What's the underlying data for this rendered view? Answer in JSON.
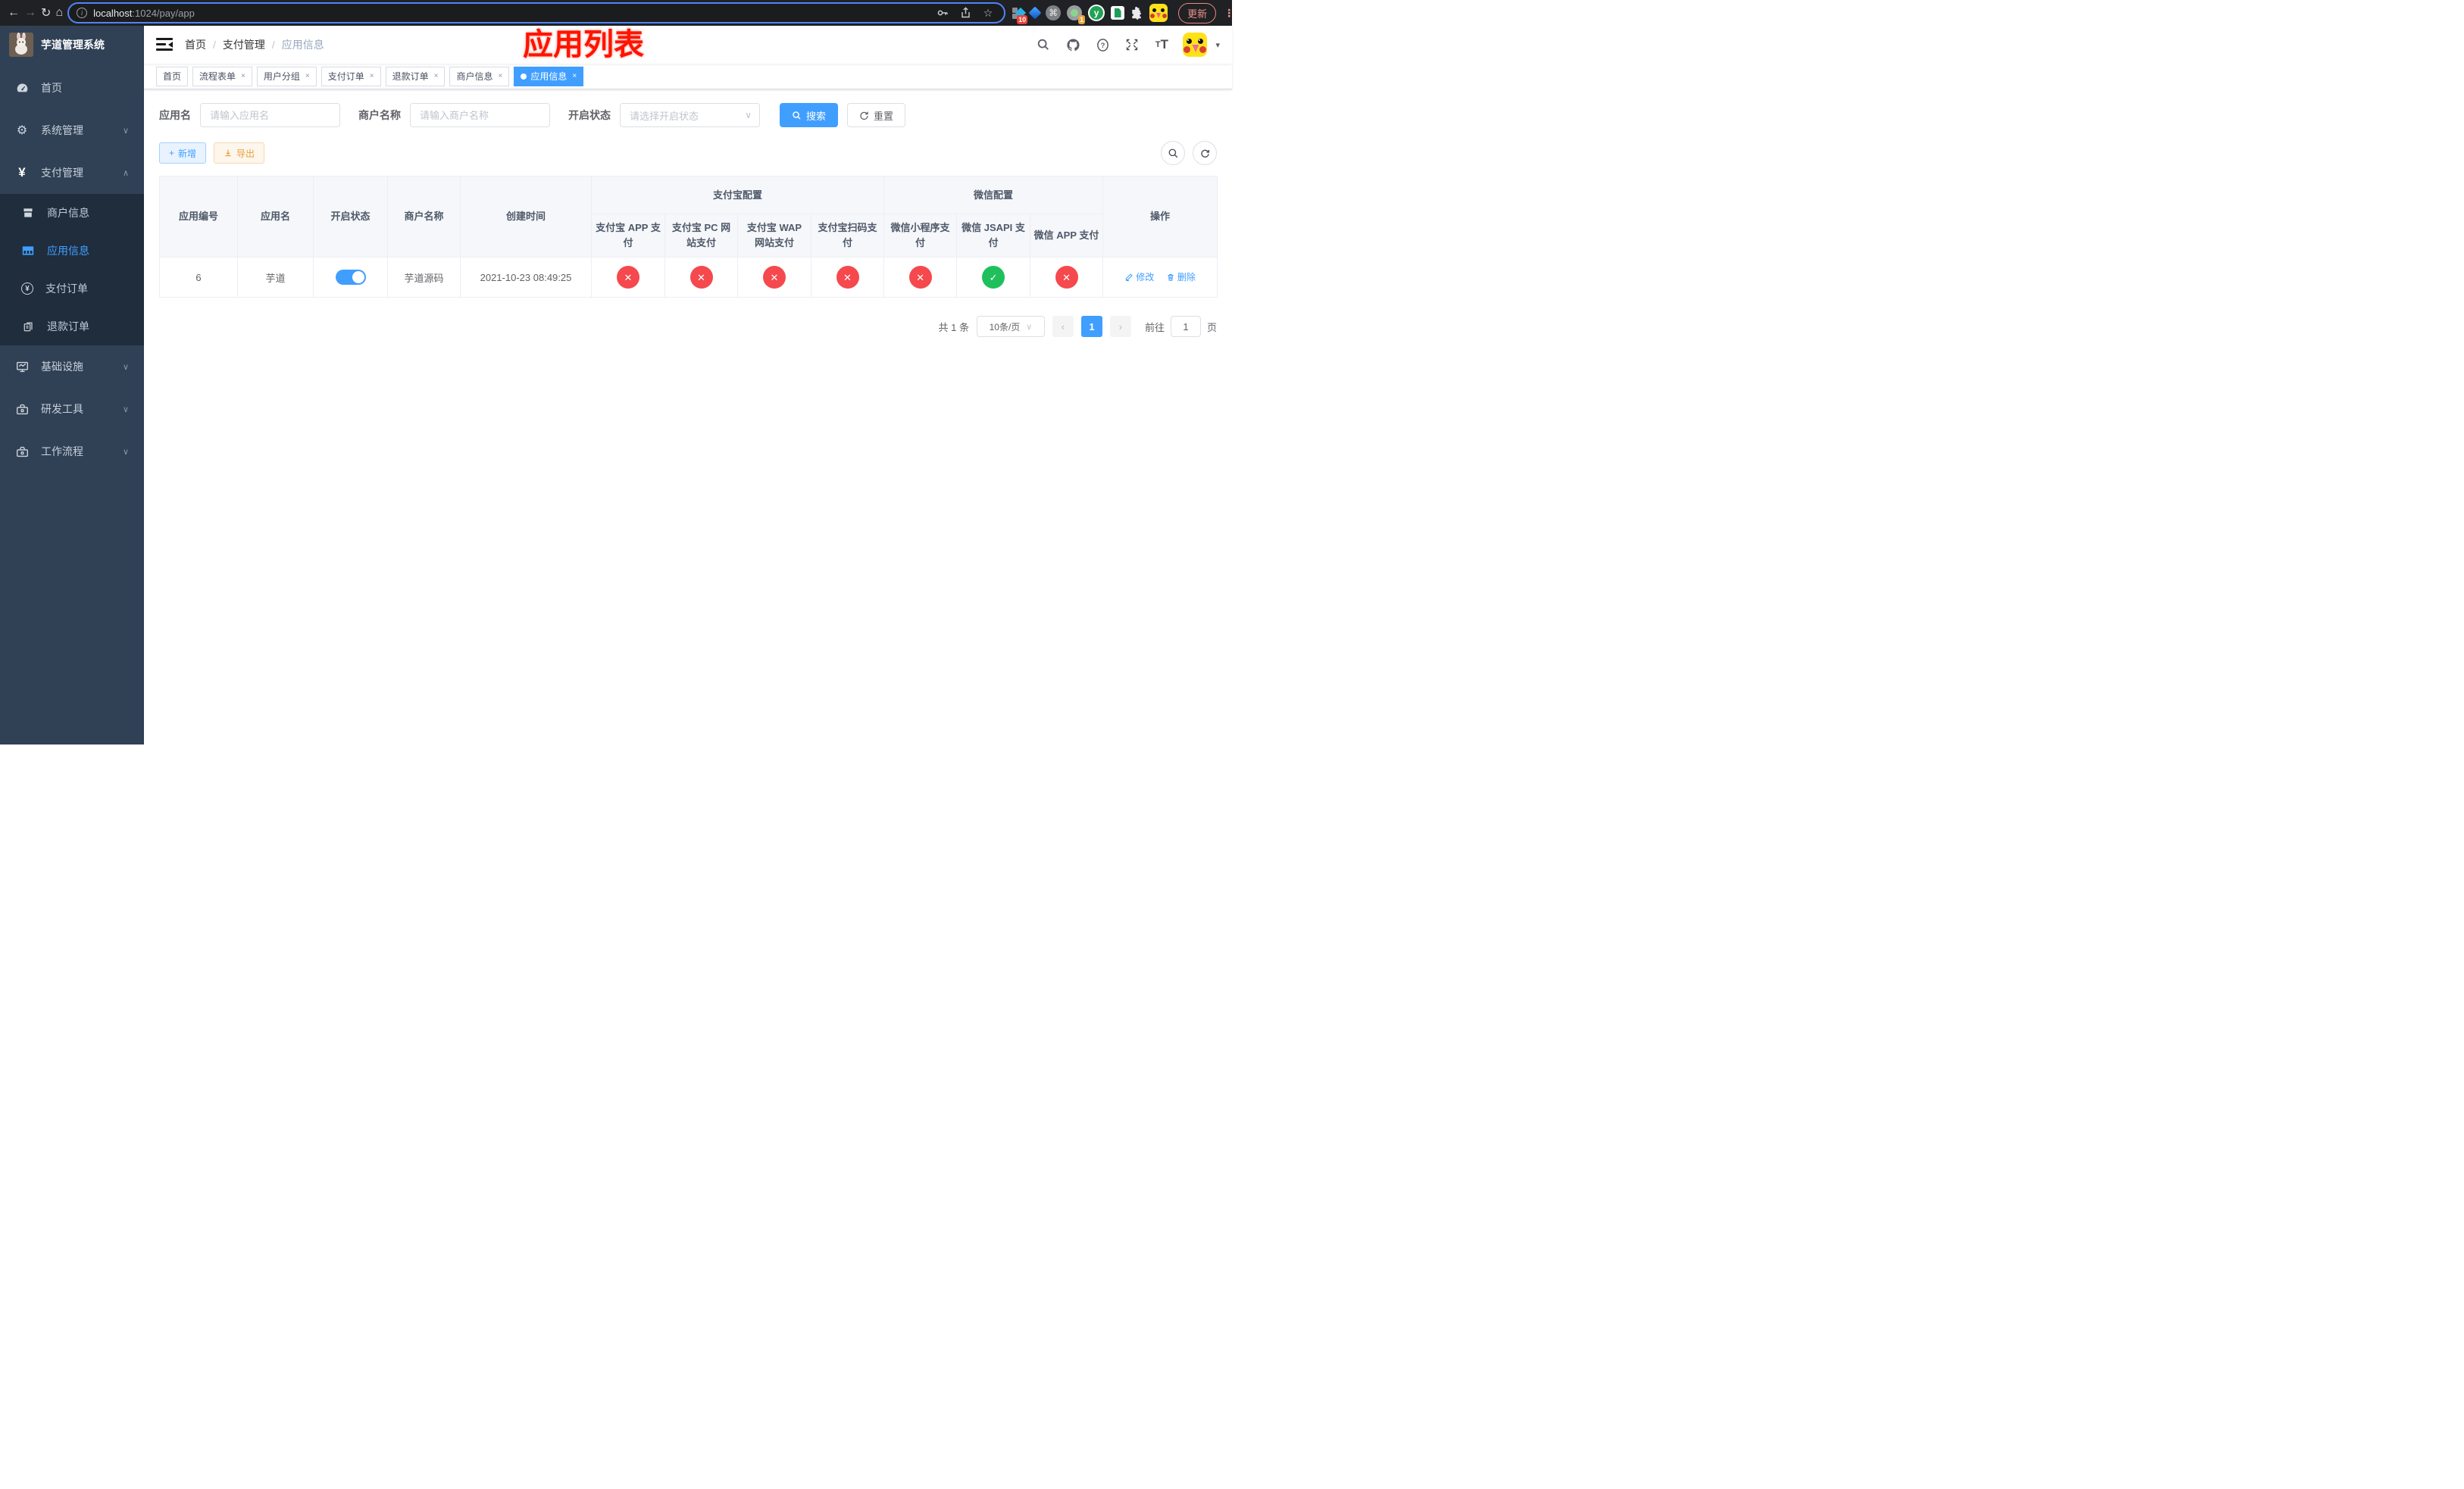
{
  "colors": {
    "accent": "#409eff",
    "danger": "#f5494d",
    "success": "#1fc05c",
    "warning": "#e6a23c",
    "sidebar_bg": "#304156",
    "submenu_bg": "#1f2d3d",
    "tab_active_bg": "#409eff",
    "annotation_red": "#fe1400"
  },
  "icons": {
    "back": "←",
    "forward": "→",
    "reload": "↻",
    "home": "⌂",
    "star": "☆",
    "cmd": "⌘",
    "kebab": "⋮",
    "caret": "▾",
    "chevron_down": "∨",
    "chevron_up": "∧",
    "prev": "‹",
    "next": "›",
    "plus": "+",
    "close": "×",
    "check": "✓",
    "yen": "¥",
    "font_size_small": "T",
    "font_size_big": "T",
    "y_letter": "y"
  },
  "browser": {
    "url_host": "localhost",
    "url_rest": ":1024/pay/app",
    "update_label": "更新",
    "ext_badge_blocks": "10",
    "ext_badge_target": "1"
  },
  "sidebar": {
    "title": "芋道管理系统",
    "items": [
      {
        "label": "首页"
      },
      {
        "label": "系统管理"
      },
      {
        "label": "支付管理"
      },
      {
        "label": "商户信息"
      },
      {
        "label": "应用信息"
      },
      {
        "label": "支付订单"
      },
      {
        "label": "退款订单"
      },
      {
        "label": "基础设施"
      },
      {
        "label": "研发工具"
      },
      {
        "label": "工作流程"
      }
    ]
  },
  "breadcrumb": [
    "首页",
    "支付管理",
    "应用信息"
  ],
  "annotation": "应用列表",
  "tabs": [
    {
      "label": "首页"
    },
    {
      "label": "流程表单"
    },
    {
      "label": "用户分组"
    },
    {
      "label": "支付订单"
    },
    {
      "label": "退款订单"
    },
    {
      "label": "商户信息"
    },
    {
      "label": "应用信息"
    }
  ],
  "filters": {
    "app_name_label": "应用名",
    "app_name_placeholder": "请输入应用名",
    "merchant_label": "商户名称",
    "merchant_placeholder": "请输入商户名称",
    "status_label": "开启状态",
    "status_placeholder": "请选择开启状态",
    "search_label": "搜索",
    "reset_label": "重置"
  },
  "toolbar": {
    "add_label": "新增",
    "export_label": "导出"
  },
  "table": {
    "glyph_ok": "✓",
    "glyph_fail": "✕",
    "group_alipay": "支付宝配置",
    "group_wechat": "微信配置",
    "columns": {
      "id": "应用编号",
      "name": "应用名",
      "enabled": "开启状态",
      "merchant": "商户名称",
      "created": "创建时间",
      "alipay_app": "支付宝 APP 支付",
      "alipay_pc": "支付宝 PC 网站支付",
      "alipay_wap": "支付宝 WAP 网站支付",
      "alipay_qr": "支付宝扫码支付",
      "wx_mini": "微信小程序支付",
      "wx_jsapi": "微信 JSAPI 支付",
      "wx_app": "微信 APP 支付",
      "op": "操作"
    },
    "row": {
      "id": "6",
      "name": "芋道",
      "enabled": true,
      "merchant": "芋道源码",
      "created_at": "2021-10-23 08:49:25",
      "statuses": [
        {
          "ok": false
        },
        {
          "ok": false
        },
        {
          "ok": false
        },
        {
          "ok": false
        },
        {
          "ok": false
        },
        {
          "ok": true
        },
        {
          "ok": false
        }
      ],
      "edit_label": "修改",
      "delete_label": "删除"
    }
  },
  "pagination": {
    "total_text": "共 1 条",
    "page_size": "10条/页",
    "current_page": "1",
    "goto_label": "前往",
    "goto_value": "1",
    "page_unit": "页"
  }
}
